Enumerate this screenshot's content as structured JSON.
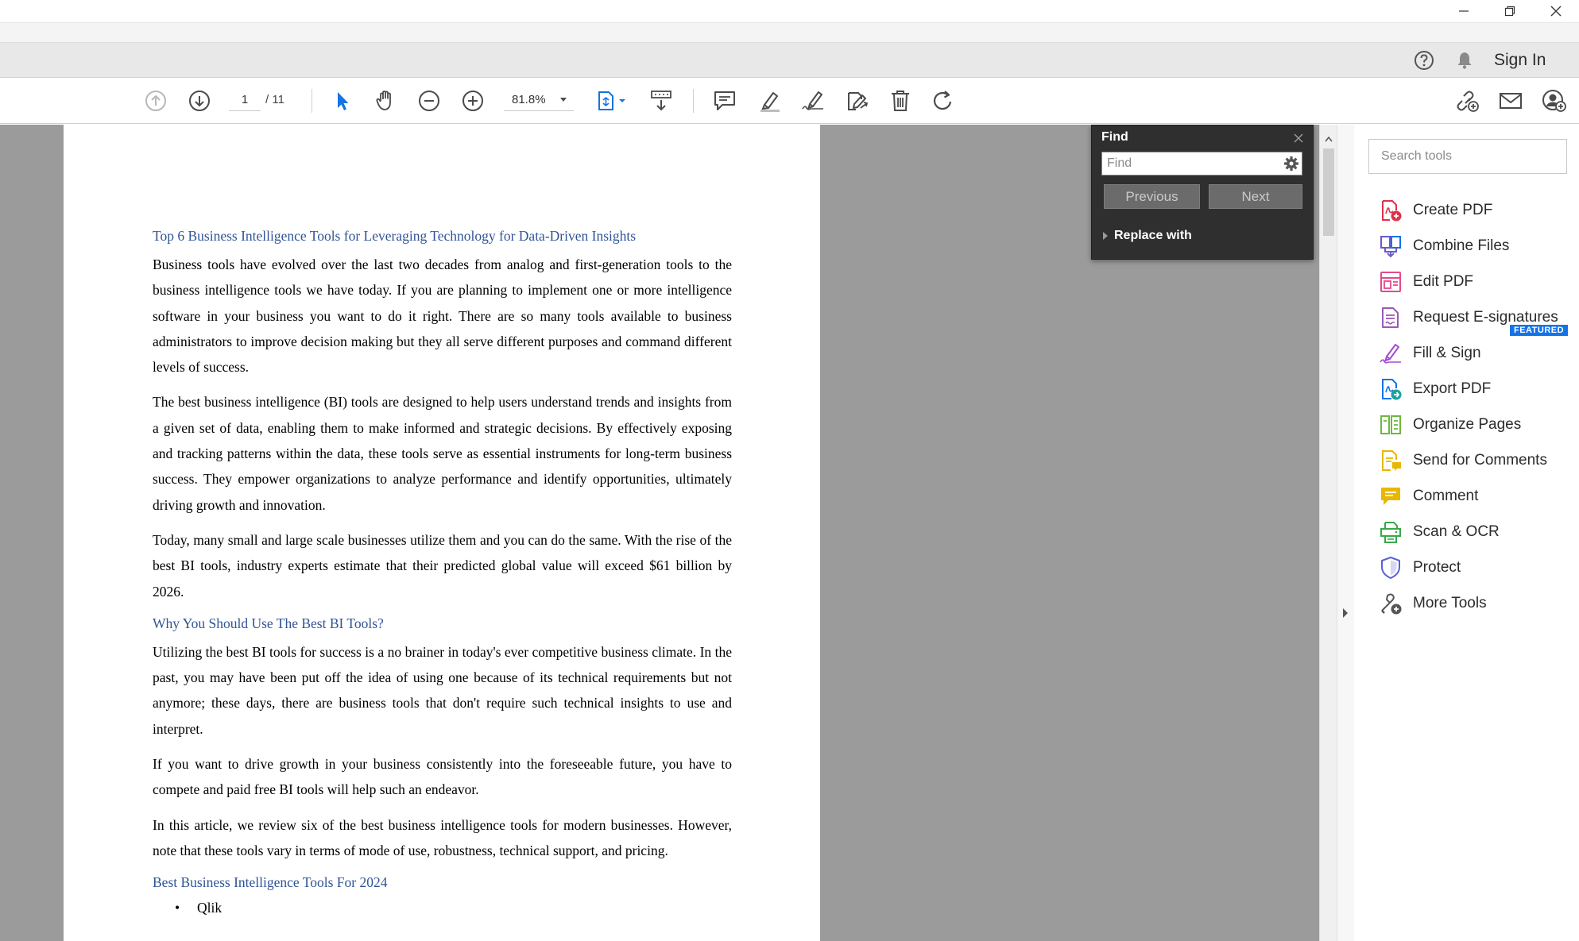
{
  "window": {
    "minimize_icon": "minimize-icon",
    "restore_icon": "restore-icon",
    "close_icon": "close-icon"
  },
  "account": {
    "help_icon": "help-icon",
    "bell_icon": "bell-icon",
    "signin_label": "Sign In"
  },
  "toolbar": {
    "page_current": "1",
    "page_total": "/ 11",
    "zoom": "81.8%"
  },
  "document": {
    "heading1": "Top 6 Business Intelligence Tools for Leveraging Technology for Data-Driven Insights",
    "para1": "Business tools have evolved over the last two decades from analog and first-generation tools to the business intelligence tools we have today.  If you are planning to implement one or more intelligence software in your business you want to do it right. There are so many tools available to business administrators to improve decision making but they all serve different purposes and command different levels of success.",
    "para2": "The best business intelligence (BI) tools are designed to help users understand trends and insights from a given set of data, enabling them to make informed and strategic decisions. By effectively exposing and tracking patterns within the data, these tools serve as essential instruments for long-term business success. They empower organizations to analyze performance and identify opportunities, ultimately driving growth and innovation.",
    "para3": "Today, many small and large scale businesses utilize them and you can do the same. With the rise of the best BI tools, industry experts estimate that their predicted global value will exceed $61 billion by 2026.",
    "heading2": "Why You Should Use The Best BI Tools?",
    "para4": "Utilizing the best BI tools for success is a no brainer in today's ever competitive business climate. In the past, you may have been put off the idea of using one because of its technical requirements but not anymore; these days, there are business tools that don't require such technical insights to use and interpret.",
    "para5": "If you want to drive growth in your business consistently into the foreseeable future, you have to compete and paid free BI tools will help such an endeavor.",
    "para6": "In this article, we review six of the best business intelligence tools for modern businesses. However, note that these tools vary in terms of mode of use, robustness, technical support, and pricing.",
    "heading3": "Best Business Intelligence Tools For 2024",
    "list_item1": "Qlik"
  },
  "find": {
    "title": "Find",
    "placeholder": "Find",
    "previous_label": "Previous",
    "next_label": "Next",
    "replace_label": "Replace with"
  },
  "tools": {
    "search_placeholder": "Search tools",
    "featured_badge": "FEATURED",
    "items": [
      {
        "label": "Create PDF",
        "icon": "create-pdf-icon",
        "color": "#e0304b"
      },
      {
        "label": "Combine Files",
        "icon": "combine-files-icon",
        "color": "#6a5acd"
      },
      {
        "label": "Edit PDF",
        "icon": "edit-pdf-icon",
        "color": "#e44a8c"
      },
      {
        "label": "Request E-signatures",
        "icon": "request-esignatures-icon",
        "color": "#9b59b6"
      },
      {
        "label": "Fill & Sign",
        "icon": "fill-sign-icon",
        "color": "#a04bd4"
      },
      {
        "label": "Export PDF",
        "icon": "export-pdf-icon",
        "color": "#1aa29e"
      },
      {
        "label": "Organize Pages",
        "icon": "organize-pages-icon",
        "color": "#6fb83e"
      },
      {
        "label": "Send for Comments",
        "icon": "send-for-comments-icon",
        "color": "#e8b800"
      },
      {
        "label": "Comment",
        "icon": "comment-icon",
        "color": "#e8b800"
      },
      {
        "label": "Scan & OCR",
        "icon": "scan-ocr-icon",
        "color": "#38a84b"
      },
      {
        "label": "Protect",
        "icon": "protect-icon",
        "color": "#5a60d6"
      },
      {
        "label": "More Tools",
        "icon": "more-tools-icon",
        "color": "#555555"
      }
    ]
  }
}
